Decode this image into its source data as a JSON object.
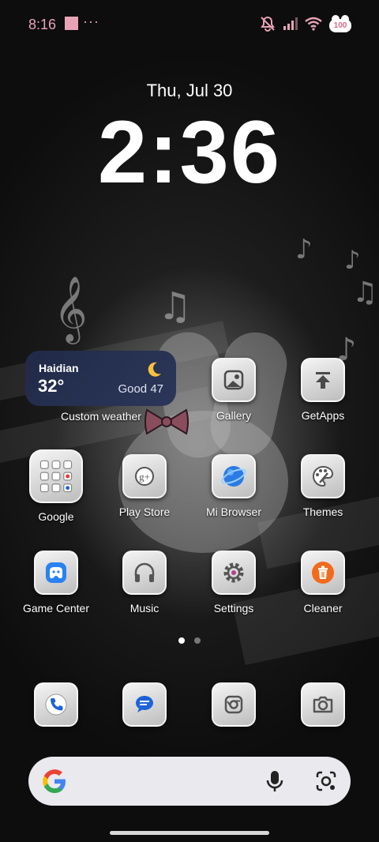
{
  "status_bar": {
    "time": "8:16",
    "dots": "···",
    "battery": "100",
    "icons": [
      "notification-square-icon",
      "mute-icon",
      "signal-icon",
      "wifi-icon",
      "battery-icon"
    ]
  },
  "lockscreen": {
    "date": "Thu, Jul 30",
    "time": "2:36"
  },
  "weather_widget": {
    "city": "Haidian",
    "temperature": "32°",
    "air_quality": "Good 47",
    "label": "Custom weather",
    "icon": "moon-icon"
  },
  "apps": {
    "gallery": "Gallery",
    "getapps": "GetApps",
    "google": "Google",
    "play_store": "Play Store",
    "mi_browser": "Mi Browser",
    "themes": "Themes",
    "game_center": "Game Center",
    "music": "Music",
    "settings": "Settings",
    "cleaner": "Cleaner"
  },
  "dock": [
    "phone-icon",
    "messages-icon",
    "chrome-icon",
    "camera-icon"
  ],
  "search": {
    "icons": [
      "google-g-icon",
      "microphone-icon",
      "lens-icon"
    ]
  },
  "pagination": {
    "current": 1,
    "total": 2
  },
  "colors": {
    "status_accent": "#e8a3b6",
    "weather_bg": "#24304f",
    "cleaner_accent": "#f26b1d",
    "browser_accent": "#2b7be4",
    "game_accent": "#2a82f0"
  }
}
